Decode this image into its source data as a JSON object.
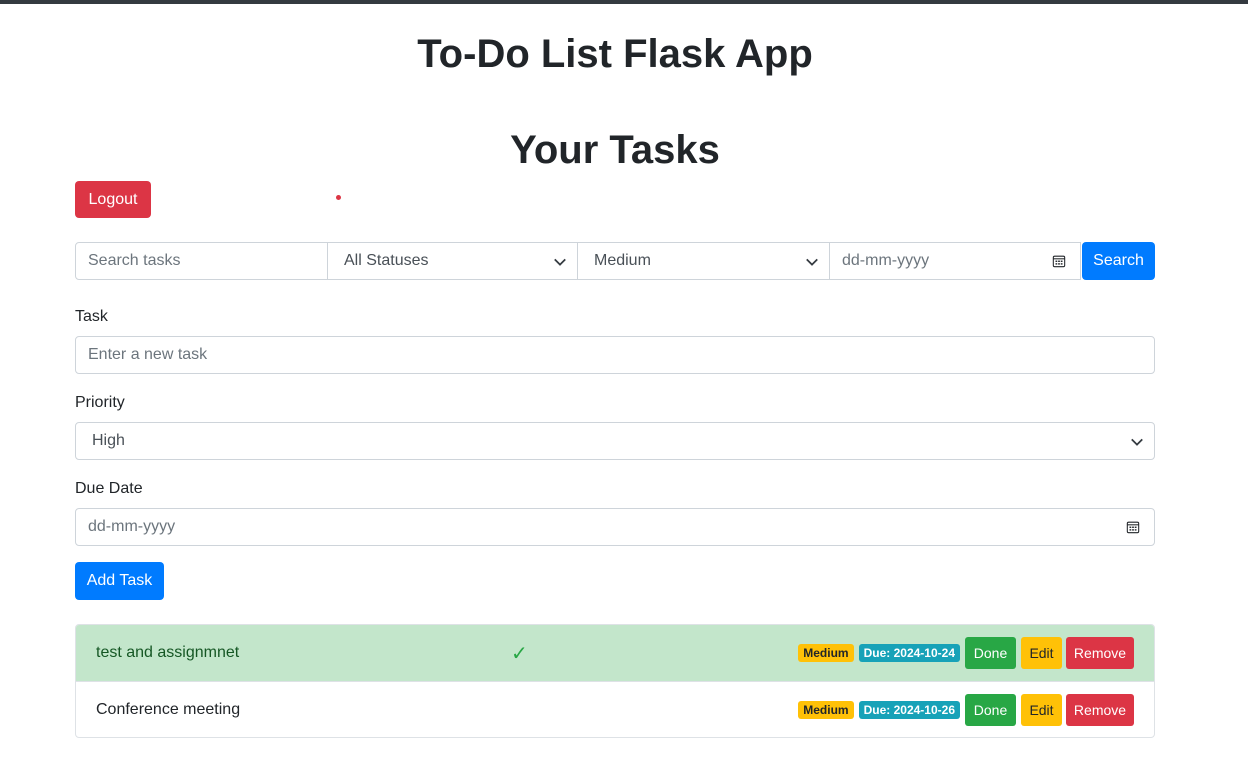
{
  "header": {
    "title": "To-Do List Flask App"
  },
  "main": {
    "section_title": "Your Tasks",
    "logout_label": "Logout"
  },
  "search": {
    "placeholder": "Search tasks",
    "status_selected": "All Statuses",
    "priority_selected": "Medium",
    "date_placeholder": "dd-mm-yyyy",
    "button_label": "Search"
  },
  "form": {
    "task_label": "Task",
    "task_placeholder": "Enter a new task",
    "priority_label": "Priority",
    "priority_selected": "High",
    "due_label": "Due Date",
    "due_placeholder": "dd-mm-yyyy",
    "add_label": "Add Task"
  },
  "tasks": [
    {
      "text": "test and assignmnet",
      "completed": true,
      "check": "✓",
      "priority": "Medium",
      "due": "Due: 2024-10-24",
      "done_label": "Done",
      "edit_label": "Edit",
      "remove_label": "Remove"
    },
    {
      "text": "Conference meeting",
      "completed": false,
      "priority": "Medium",
      "due": "Due: 2024-10-26",
      "done_label": "Done",
      "edit_label": "Edit",
      "remove_label": "Remove"
    }
  ],
  "colors": {
    "primary": "#007bff",
    "danger": "#dc3545",
    "success": "#28a745",
    "warning": "#ffc107",
    "info": "#17a2b8",
    "completed_row": "#c3e6cb"
  },
  "icons": {
    "dropdown": "chevron-down-icon",
    "date": "calendar-icon",
    "completed": "checkmark-icon"
  }
}
